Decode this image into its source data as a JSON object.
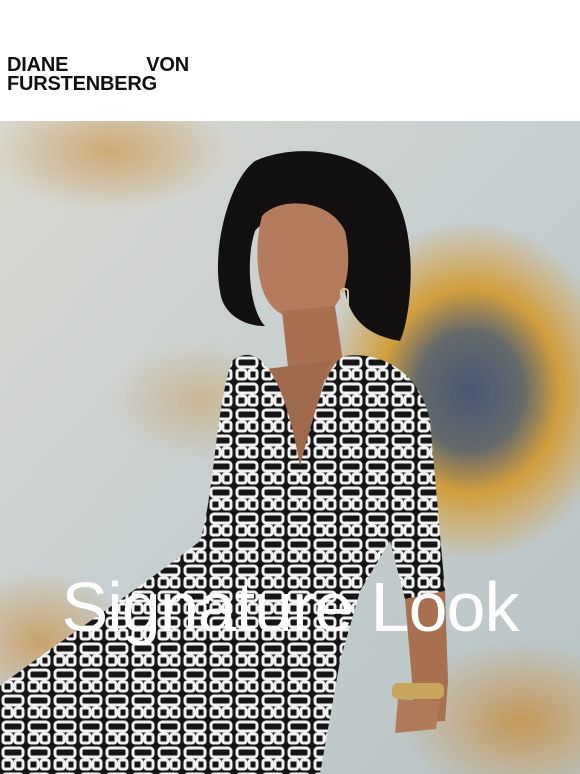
{
  "brand": {
    "line1_left": "DIANE",
    "line1_right": "VON",
    "line2": "FURSTENBERG"
  },
  "hero": {
    "headline": "Signature Look",
    "image_alt": "Model seated wearing a black and white chain-link print wrap dress against a painted backdrop",
    "colors": {
      "backdrop": "#c9d0cd",
      "sunflower": "#c98d2a",
      "dress_dark": "#1a1a1a",
      "dress_light": "#f2f2f2"
    }
  }
}
